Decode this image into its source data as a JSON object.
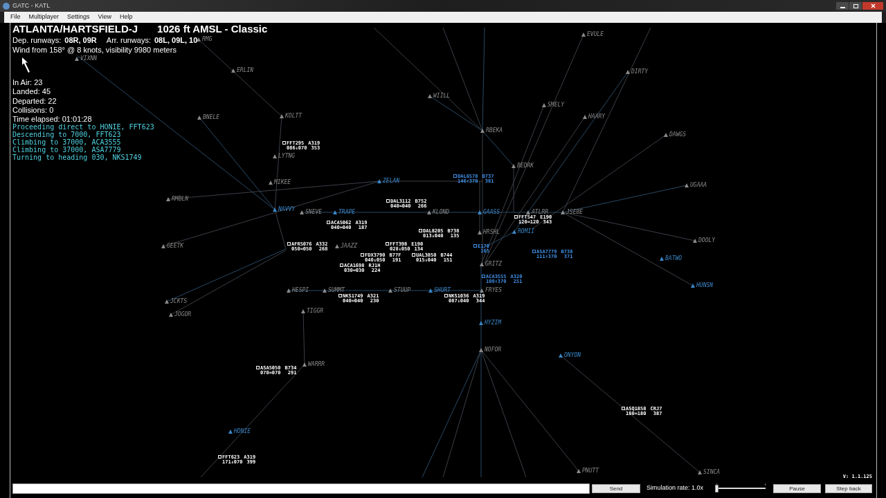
{
  "window": {
    "title": "GATC - KATL"
  },
  "menu": [
    "File",
    "Multiplayer",
    "Settings",
    "View",
    "Help"
  ],
  "airport": {
    "name": "ATLANTA/HARTSFIELD-J",
    "elevation": "1026 ft AMSL - Classic",
    "dep_label": "Dep. runways:",
    "dep_runways": "08R, 09R",
    "arr_label": "Arr. runways:",
    "arr_runways": "08L, 09L, 10",
    "wind": "Wind from 158° @ 8 knots, visibility 9980 meters"
  },
  "stats": [
    "In Air: 23",
    "Landed: 45",
    "Departed: 22",
    "Collisions: 0",
    "Time elapsed: 01:01:28"
  ],
  "messages": [
    "Proceeding direct to HONIE, FFT623",
    "Descending to 7000, FFT623",
    "Climbing to 37000, ACA3555",
    "Climbing to 37000, ASA7779",
    "Turning to heading 030, NKS1749"
  ],
  "waypoints": [
    {
      "name": "EVULE",
      "active": false
    },
    {
      "name": "RMG",
      "active": false
    },
    {
      "name": "VIXNN",
      "active": false
    },
    {
      "name": "ERLIN",
      "active": false
    },
    {
      "name": "DIRTY",
      "active": false
    },
    {
      "name": "WIILL",
      "active": false
    },
    {
      "name": "SMELY",
      "active": false
    },
    {
      "name": "BNELE",
      "active": false
    },
    {
      "name": "KOLTT",
      "active": false
    },
    {
      "name": "HAARY",
      "active": false
    },
    {
      "name": "RBEKA",
      "active": false
    },
    {
      "name": "DAWGS",
      "active": false
    },
    {
      "name": "LYTNG",
      "active": false
    },
    {
      "name": "BEDRK",
      "active": false
    },
    {
      "name": "MIKEE",
      "active": false
    },
    {
      "name": "ZELAN",
      "active": true
    },
    {
      "name": "UGAAA",
      "active": false
    },
    {
      "name": "RMBLN",
      "active": false
    },
    {
      "name": "NAVVY",
      "active": true
    },
    {
      "name": "SNEVE",
      "active": false
    },
    {
      "name": "TRAPE",
      "active": true
    },
    {
      "name": "KLOND",
      "active": false
    },
    {
      "name": "GAASS",
      "active": true
    },
    {
      "name": "ATLRR",
      "active": false
    },
    {
      "name": "JSEBE",
      "active": false
    },
    {
      "name": "HRSHL",
      "active": false
    },
    {
      "name": "ROMII",
      "active": true
    },
    {
      "name": "DOOLY",
      "active": false
    },
    {
      "name": "GEETK",
      "active": false
    },
    {
      "name": "JAAZZ",
      "active": false
    },
    {
      "name": "BATWO",
      "active": true
    },
    {
      "name": "GRITZ",
      "active": false
    },
    {
      "name": "HUNSN",
      "active": true
    },
    {
      "name": "HESPI",
      "active": false
    },
    {
      "name": "SUMMT",
      "active": false
    },
    {
      "name": "STUUP",
      "active": false
    },
    {
      "name": "SHURT",
      "active": true
    },
    {
      "name": "FRYES",
      "active": false
    },
    {
      "name": "JCKTS",
      "active": false
    },
    {
      "name": "TIGGR",
      "active": false
    },
    {
      "name": "JOGOR",
      "active": false
    },
    {
      "name": "HYZIM",
      "active": true
    },
    {
      "name": "NOFOR",
      "active": false
    },
    {
      "name": "ONYON",
      "active": true
    },
    {
      "name": "WARRR",
      "active": false
    },
    {
      "name": "HONIE",
      "active": true
    },
    {
      "name": "PNUTT",
      "active": false
    },
    {
      "name": "SINCA",
      "active": false
    }
  ],
  "aircraft": [
    {
      "callsign": "FFT295",
      "type": "A319",
      "altitude": "086↓070",
      "speed": "353",
      "highlighted": false
    },
    {
      "callsign": "DAL6578",
      "type": "B737",
      "altitude": "146↑370",
      "speed": "381",
      "highlighted": true
    },
    {
      "callsign": "DAL3112",
      "type": "B752",
      "altitude": "040=040",
      "speed": "266",
      "highlighted": false
    },
    {
      "callsign": "FFT547",
      "type": "E190",
      "altitude": "120=120",
      "speed": "343",
      "highlighted": false
    },
    {
      "callsign": "ACA5062",
      "type": "A319",
      "altitude": "040=040",
      "speed": "187",
      "highlighted": false
    },
    {
      "callsign": "DAL8205",
      "type": "B738",
      "altitude": "013↓040",
      "speed": "135",
      "highlighted": false
    },
    {
      "callsign": "AFR5076",
      "type": "A332",
      "altitude": "050=050",
      "speed": "268",
      "highlighted": false
    },
    {
      "callsign": "FFT398",
      "type": "E190",
      "altitude": "028↓050",
      "speed": "134",
      "highlighted": false
    },
    {
      "type": "E170",
      "speed": "165",
      "highlighted": true
    },
    {
      "callsign": "ASA7779",
      "type": "B738",
      "altitude": "111↑370",
      "speed": "371",
      "highlighted": true
    },
    {
      "callsign": "FDX3790",
      "type": "B77F",
      "altitude": "040↓050",
      "speed": "191",
      "highlighted": false
    },
    {
      "callsign": "UAL3850",
      "type": "B744",
      "altitude": "015↓040",
      "speed": "151",
      "highlighted": false
    },
    {
      "callsign": "ACA1698",
      "type": "RJ1H",
      "altitude": "030=030",
      "speed": "224",
      "highlighted": false
    },
    {
      "callsign": "ACA3555",
      "type": "A320",
      "altitude": "109↑370",
      "speed": "251",
      "highlighted": true
    },
    {
      "callsign": "NKS1749",
      "type": "A321",
      "altitude": "040=040",
      "speed": "230",
      "highlighted": false
    },
    {
      "callsign": "NKS1036",
      "type": "A319",
      "altitude": "087↓040",
      "speed": "344",
      "highlighted": false
    },
    {
      "callsign": "ASA5050",
      "type": "B734",
      "altitude": "070=070",
      "speed": "291",
      "highlighted": false
    },
    {
      "callsign": "ASQ1858",
      "type": "CRJ7",
      "altitude": "180=180",
      "speed": "387",
      "highlighted": false
    },
    {
      "callsign": "FFT623",
      "type": "A319",
      "altitude": "171↓070",
      "speed": "399",
      "highlighted": false
    }
  ],
  "command": {
    "send": "Send",
    "rate": "Simulation rate: 1.0x",
    "rate_slider": {
      "level": 0
    },
    "pause": "Pause",
    "step_back": "Step back",
    "version": "V: 1.1.125"
  }
}
